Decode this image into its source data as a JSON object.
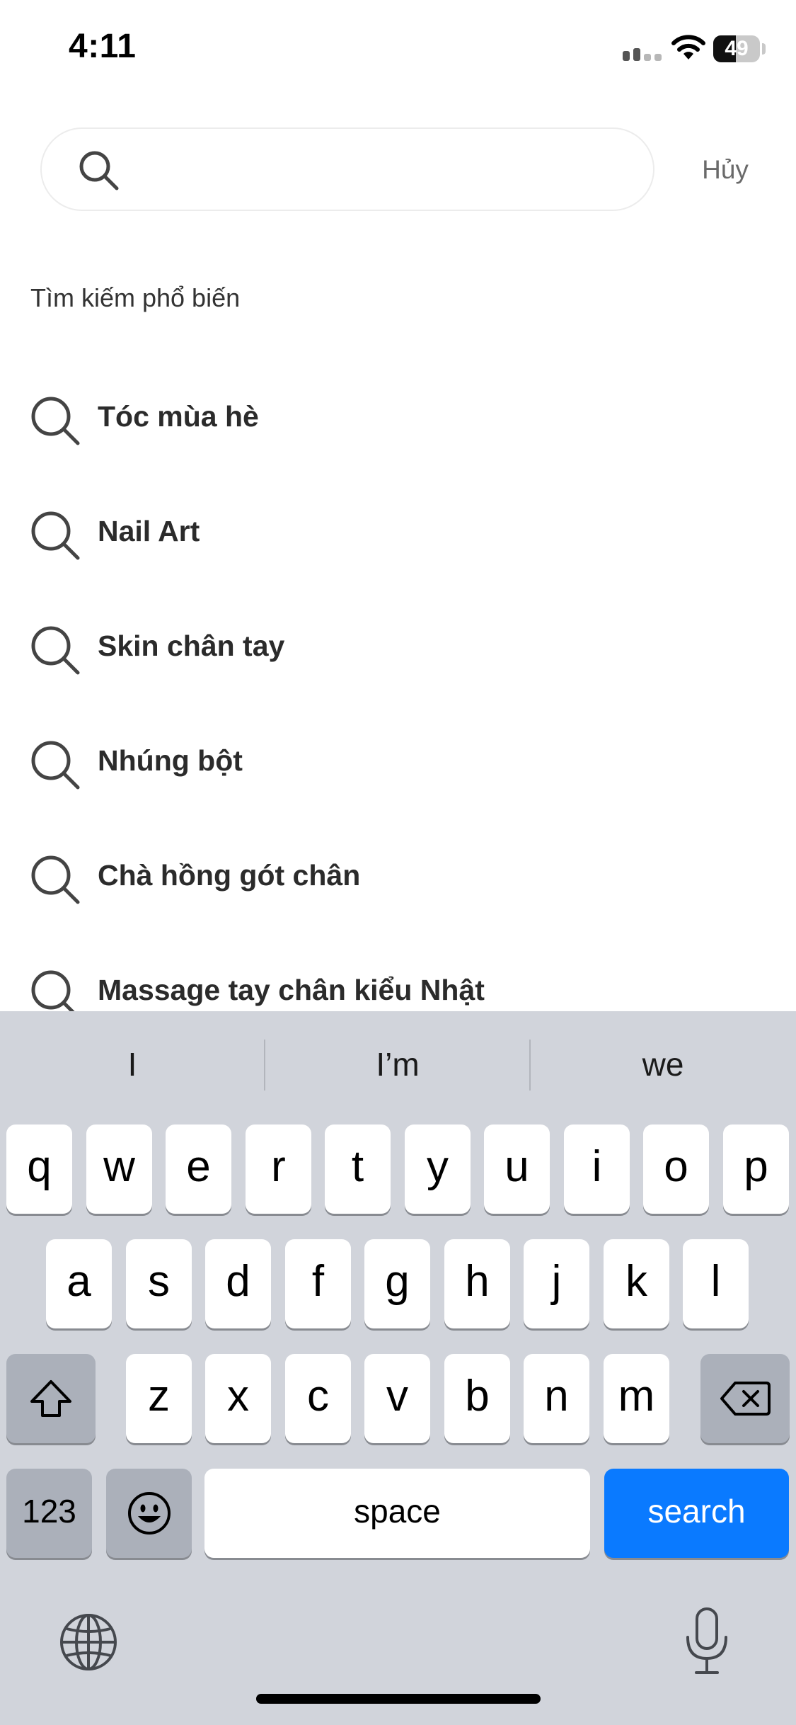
{
  "status_bar": {
    "time": "4:11",
    "battery_level": "49",
    "signal_icon": "cellular-signal-icon",
    "wifi_icon": "wifi-icon",
    "battery_icon": "battery-icon"
  },
  "search": {
    "placeholder": "",
    "value": "",
    "icon": "search-icon",
    "cancel_label": "Hủy"
  },
  "popular": {
    "title": "Tìm kiếm phổ biến",
    "items": [
      {
        "label": "Tóc mùa hè",
        "icon": "search-icon"
      },
      {
        "label": "Nail Art",
        "icon": "search-icon"
      },
      {
        "label": "Skin chân tay",
        "icon": "search-icon"
      },
      {
        "label": "Nhúng bột",
        "icon": "search-icon"
      },
      {
        "label": "Chà hồng gót chân",
        "icon": "search-icon"
      },
      {
        "label": "Massage tay chân kiểu Nhật",
        "icon": "search-icon"
      }
    ]
  },
  "keyboard": {
    "predictions": [
      "I",
      "I’m",
      "we"
    ],
    "row1": [
      "q",
      "w",
      "e",
      "r",
      "t",
      "y",
      "u",
      "i",
      "o",
      "p"
    ],
    "row2": [
      "a",
      "s",
      "d",
      "f",
      "g",
      "h",
      "j",
      "k",
      "l"
    ],
    "row3": [
      "z",
      "x",
      "c",
      "v",
      "b",
      "n",
      "m"
    ],
    "shift_icon": "shift-icon",
    "delete_icon": "backspace-icon",
    "numbers_label": "123",
    "emoji_icon": "emoji-icon",
    "space_label": "space",
    "search_label": "search",
    "globe_icon": "globe-icon",
    "mic_icon": "microphone-icon",
    "colors": {
      "background": "#d1d4db",
      "key": "#ffffff",
      "dark_key": "#abb0ba",
      "action_key": "#0a7aff"
    }
  }
}
